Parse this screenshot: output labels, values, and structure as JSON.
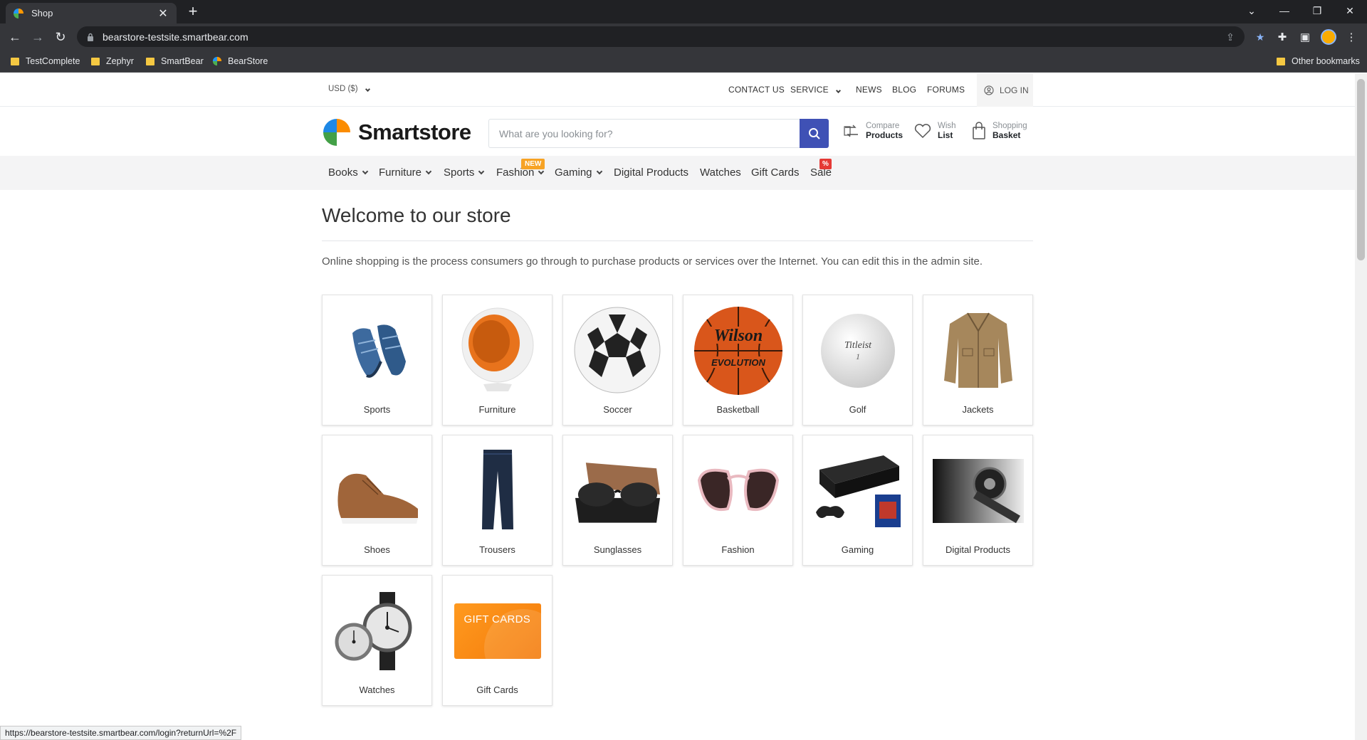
{
  "browser": {
    "tab_title": "Shop",
    "url": "bearstore-testsite.smartbear.com",
    "bookmarks": [
      "TestComplete",
      "Zephyr",
      "SmartBear",
      "BearStore"
    ],
    "other_bookmarks": "Other bookmarks",
    "status_url": "https://bearstore-testsite.smartbear.com/login?returnUrl=%2F"
  },
  "topbar": {
    "currency": "USD  ($)",
    "links": {
      "contact": "CONTACT US",
      "service": "SERVICE",
      "news": "NEWS",
      "blog": "BLOG",
      "forums": "FORUMS",
      "login": "LOG IN"
    }
  },
  "header": {
    "logo_text": "Smartstore",
    "search_placeholder": "What are you looking for?",
    "compare": {
      "line1": "Compare",
      "line2": "Products"
    },
    "wishlist": {
      "line1": "Wish",
      "line2": "List"
    },
    "basket": {
      "line1": "Shopping",
      "line2": "Basket"
    }
  },
  "nav": {
    "items": [
      "Books",
      "Furniture",
      "Sports",
      "Fashion",
      "Gaming",
      "Digital Products",
      "Watches",
      "Gift Cards",
      "Sale"
    ],
    "badge_new": "NEW",
    "badge_sale": "%"
  },
  "main": {
    "title": "Welcome to our store",
    "intro": "Online shopping is the process consumers go through to purchase products or services over the Internet. You can edit this in the admin site.",
    "categories": [
      "Sports",
      "Furniture",
      "Soccer",
      "Basketball",
      "Golf",
      "Jackets",
      "Shoes",
      "Trousers",
      "Sunglasses",
      "Fashion",
      "Gaming",
      "Digital Products",
      "Watches",
      "Gift Cards"
    ],
    "gift_card_text": "GIFT CARDS"
  },
  "colors": {
    "accent": "#3f51b5",
    "new_badge": "#f7a325",
    "sale_badge": "#e53935"
  }
}
